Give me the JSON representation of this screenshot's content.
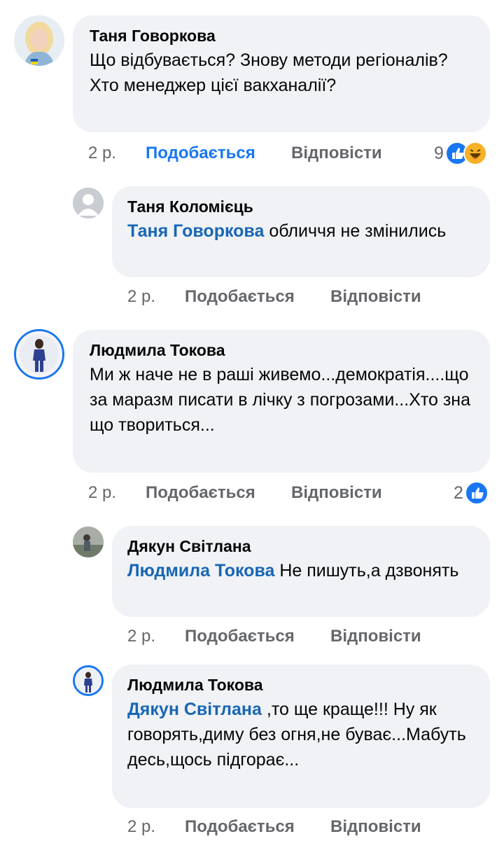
{
  "comments": [
    {
      "author": "Таня Говоркова",
      "text": "Що відбувається? Знову методи регіоналів? Хто менеджер цієї вакханалії?",
      "time": "2 р.",
      "like_label": "Подобається",
      "reply_label": "Відповісти",
      "reaction_count": "9",
      "reactions": [
        "like",
        "haha"
      ],
      "liked": true
    },
    {
      "author": "Таня Коломієць",
      "mention": "Таня Говоркова",
      "text": "обличчя не змінились",
      "time": "2 р.",
      "like_label": "Подобається",
      "reply_label": "Відповісти"
    },
    {
      "author": "Людмила Токова",
      "text": "Ми ж наче не в раші живемо...демократія....що за маразм писати в лічку з погрозами...Хто зна що твориться...",
      "time": "2 р.",
      "like_label": "Подобається",
      "reply_label": "Відповісти",
      "reaction_count": "2",
      "reactions": [
        "like"
      ]
    },
    {
      "author": "Дякун Світлана",
      "mention": "Людмила Токова",
      "text": "Не пишуть,а дзвонять",
      "time": "2 р.",
      "like_label": "Подобається",
      "reply_label": "Відповісти"
    },
    {
      "author": "Людмила Токова",
      "mention": "Дякун Світлана",
      "text": ",то ще краще!!! Ну як говорять,диму без огня,не буває...Мабуть десь,щось підгорає...",
      "time": "2 р.",
      "like_label": "Подобається",
      "reply_label": "Відповісти"
    }
  ],
  "colors": {
    "accent": "#1877f2",
    "mention": "#1866b4",
    "bubble": "#f0f2f5",
    "meta_text": "#65676b",
    "haha_yellow": "#f7b125"
  }
}
